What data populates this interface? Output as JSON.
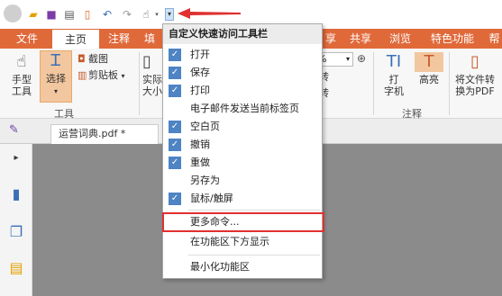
{
  "qat": {
    "dropdown_symbol": "▾"
  },
  "tabs": [
    "文件",
    "主页",
    "注释",
    "填",
    "享",
    "共享",
    "浏览",
    "特色功能",
    "帮"
  ],
  "ribbon": {
    "hand_label_1": "手型",
    "hand_label_2": "工具",
    "select_label": "选择",
    "screenshot_label": "截图",
    "clipboard_label": "剪贴板",
    "actual_label_1": "实际",
    "actual_label_2": "大小",
    "zoom_value": "0%",
    "tool_group_label": "工具",
    "zoom_label_1": "转",
    "zoom_label_2": "转",
    "typewriter_label_1": "打",
    "typewriter_label_2": "字机",
    "highlight_label": "高亮",
    "convert_label_1": "将文件转",
    "convert_label_2": "换为PDF",
    "comment_group_label": "注释"
  },
  "doc_tab": {
    "title": "运营词典.pdf *"
  },
  "menu": {
    "title": "自定义快速访问工具栏",
    "items": [
      {
        "label": "打开",
        "checked": true
      },
      {
        "label": "保存",
        "checked": true
      },
      {
        "label": "打印",
        "checked": true
      },
      {
        "label": "电子邮件发送当前标签页",
        "checked": false
      },
      {
        "label": "空白页",
        "checked": true
      },
      {
        "label": "撤销",
        "checked": true
      },
      {
        "label": "重做",
        "checked": true
      },
      {
        "label": "另存为",
        "checked": false
      },
      {
        "label": "鼠标/触屏",
        "checked": true
      }
    ],
    "more_commands": "更多命令...",
    "show_below": "在功能区下方显示",
    "minimize": "最小化功能区"
  },
  "colors": {
    "tab_bar": "#e0693a",
    "check": "#4e83c4",
    "highlight_box": "#e03030",
    "arrow": "#e03030"
  }
}
